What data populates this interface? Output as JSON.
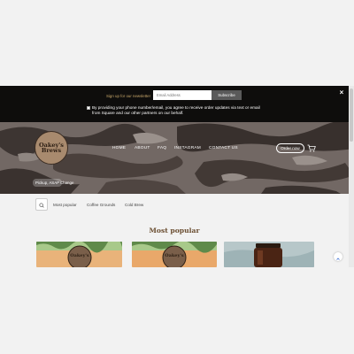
{
  "newsletter": {
    "label": "Sign up for our newsletter",
    "email_placeholder": "Email Address",
    "subscribe_label": "Subscribe",
    "close_label": "×",
    "consent_text": "By providing your phone number/email, you agree to receive order updates via text or email from Square and our other partners on our behalf."
  },
  "header": {
    "logo_text": "Oakey's Brews",
    "nav": [
      "HOME",
      "ABOUT",
      "FAQ",
      "INSTAGRAM",
      "CONTACT US"
    ],
    "order_label": "Order now",
    "cart_icon": "cart-icon",
    "fulfillment": [
      "Pickup, ASAP",
      "Change"
    ]
  },
  "filters": {
    "search_icon": "search-icon",
    "categories": [
      "Most popular",
      "Coffee Grounds",
      "Cold Brew"
    ]
  },
  "section": {
    "title": "Most popular"
  },
  "colors": {
    "banner": "#0e0d0c",
    "accent": "#c9a86b",
    "title": "#6a4d30"
  }
}
